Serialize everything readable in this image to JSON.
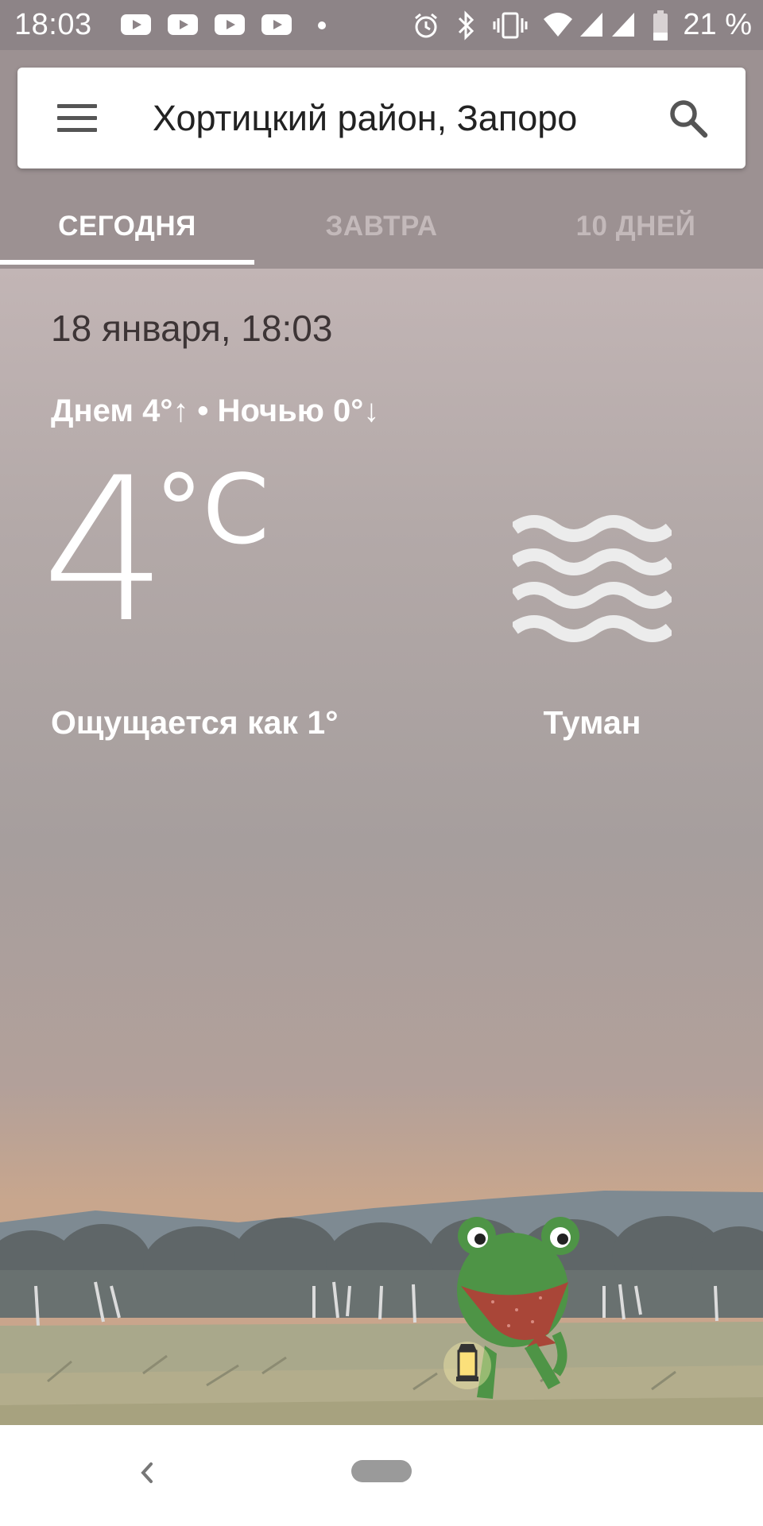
{
  "status_bar": {
    "time": "18:03",
    "battery_text": "21 %",
    "icons": [
      "youtube-icon",
      "youtube-icon",
      "youtube-icon",
      "youtube-icon",
      "dot-icon",
      "alarm-icon",
      "bluetooth-icon",
      "vibrate-icon",
      "wifi-icon",
      "signal-icon",
      "signal-icon",
      "battery-icon"
    ]
  },
  "search": {
    "location": "Хортицкий район, Запоро"
  },
  "tabs": [
    {
      "label": "СЕГОДНЯ",
      "active": true
    },
    {
      "label": "ЗАВТРА",
      "active": false
    },
    {
      "label": "10 ДНЕЙ",
      "active": false
    }
  ],
  "weather": {
    "date_time": "18 января, 18:03",
    "high_low": "Днем 4°↑ • Ночью 0°↓",
    "temperature": "4",
    "unit": "°C",
    "feels_like": "Ощущается как 1°",
    "condition": "Туман",
    "condition_icon": "fog-icon"
  },
  "colors": {
    "status_bar": "#8d8487",
    "header": "#9c9192",
    "tab_active": "#ffffff",
    "tab_inactive": "#c3b9ba"
  }
}
